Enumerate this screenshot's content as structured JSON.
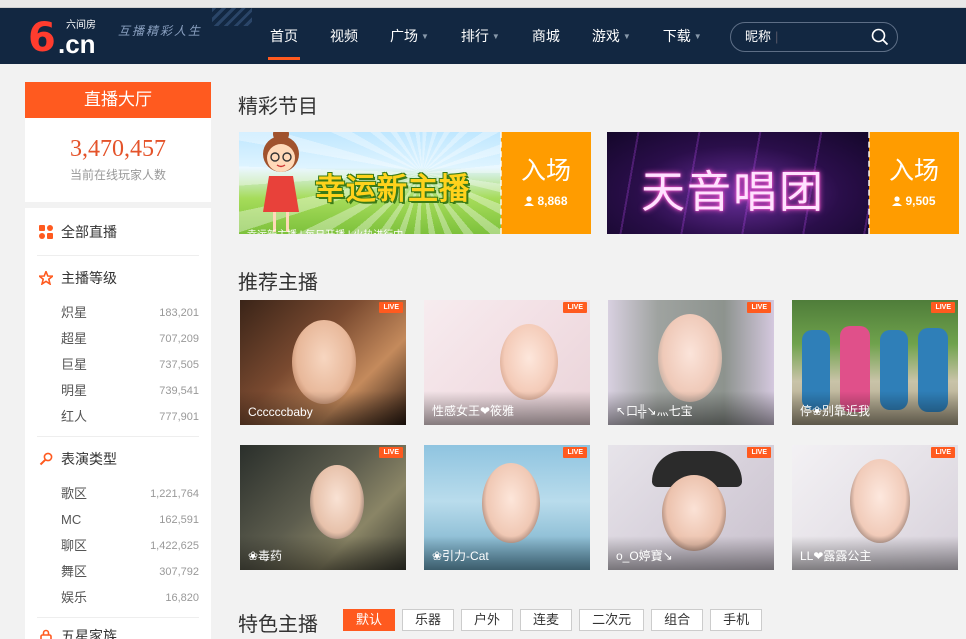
{
  "header": {
    "logo_num": "6",
    "logo_domain": ".cn",
    "logo_sub": "六间房",
    "slogan": "互播精彩人生",
    "nav": [
      {
        "label": "首页",
        "active": true,
        "has_caret": false
      },
      {
        "label": "视频",
        "active": false,
        "has_caret": false
      },
      {
        "label": "广场",
        "active": false,
        "has_caret": true
      },
      {
        "label": "排行",
        "active": false,
        "has_caret": true
      },
      {
        "label": "商城",
        "active": false,
        "has_caret": false
      },
      {
        "label": "游戏",
        "active": false,
        "has_caret": true
      },
      {
        "label": "下载",
        "active": false,
        "has_caret": true
      }
    ],
    "search_placeholder": "昵称"
  },
  "sidebar": {
    "title": "直播大厅",
    "online_count": "3,470,457",
    "online_label": "当前在线玩家人数",
    "all_live": "全部直播",
    "sections": [
      {
        "title": "主播等级",
        "icon": "star-icon",
        "items": [
          {
            "name": "炽星",
            "count": "183,201"
          },
          {
            "name": "超星",
            "count": "707,209"
          },
          {
            "name": "巨星",
            "count": "737,505"
          },
          {
            "name": "明星",
            "count": "739,541"
          },
          {
            "name": "红人",
            "count": "777,901"
          }
        ]
      },
      {
        "title": "表演类型",
        "icon": "microphone-icon",
        "items": [
          {
            "name": "歌区",
            "count": "1,221,764"
          },
          {
            "name": "MC",
            "count": "162,591"
          },
          {
            "name": "聊区",
            "count": "1,422,625"
          },
          {
            "name": "舞区",
            "count": "307,792"
          },
          {
            "name": "娱乐",
            "count": "16,820"
          }
        ]
      }
    ],
    "family_title": "五星家族"
  },
  "featured": {
    "title": "精彩节目",
    "items": [
      {
        "banner_text": "幸运新主播",
        "caption": "幸运新主播 | 每日开播 | 火热进行中",
        "enter": "入场",
        "viewers": "8,868"
      },
      {
        "banner_text": "天音唱团",
        "enter": "入场",
        "viewers": "9,505"
      }
    ]
  },
  "recommended": {
    "title": "推荐主播",
    "live_label": "LIVE",
    "streamers": [
      {
        "name": "Ccccccbaby"
      },
      {
        "name": "性感女王❤筱雅"
      },
      {
        "name": "↖口╬↘灬七宝"
      },
      {
        "name": "停❀别靠近我"
      },
      {
        "name": "❀毒药"
      },
      {
        "name": "❀引力-Cat"
      },
      {
        "name": "o_O婷寶↘"
      },
      {
        "name": "LL❤露露公主"
      }
    ]
  },
  "special": {
    "title": "特色主播",
    "tags": [
      {
        "label": "默认",
        "active": true
      },
      {
        "label": "乐器",
        "active": false
      },
      {
        "label": "户外",
        "active": false
      },
      {
        "label": "连麦",
        "active": false
      },
      {
        "label": "二次元",
        "active": false
      },
      {
        "label": "组合",
        "active": false
      },
      {
        "label": "手机",
        "active": false
      }
    ]
  },
  "colors": {
    "header_bg": "#122741",
    "accent": "#ff5a1f",
    "enter_bg": "#ff9c00",
    "count_red": "#e4532a"
  }
}
